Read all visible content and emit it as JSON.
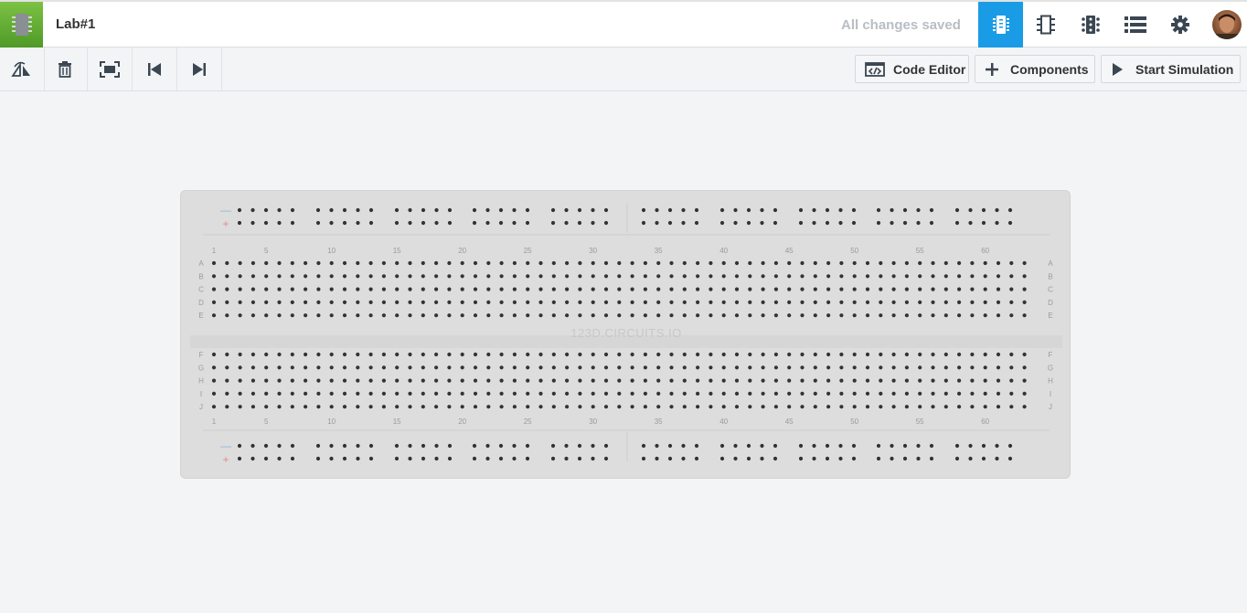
{
  "header": {
    "project_title": "Lab#1",
    "save_status": "All changes saved",
    "views": [
      {
        "name": "breadboard-view",
        "icon": "breadboard-chip-icon",
        "active": true
      },
      {
        "name": "schematic-view",
        "icon": "schematic-chip-icon",
        "active": false
      },
      {
        "name": "pcb-view",
        "icon": "pcb-chip-icon",
        "active": false
      },
      {
        "name": "component-list",
        "icon": "list-icon",
        "active": false
      },
      {
        "name": "settings",
        "icon": "gear-icon",
        "active": false
      }
    ],
    "colors": {
      "accent": "#1a9be6",
      "logo": "#6ab43a"
    }
  },
  "toolbar": {
    "tools": [
      "rotate-icon",
      "trash-icon",
      "fit-to-screen-icon",
      "step-back-icon",
      "step-forward-icon"
    ],
    "code_editor_label": "Code Editor",
    "components_label": "Components",
    "start_simulation_label": "Start Simulation"
  },
  "breadboard": {
    "brand": "123D.CIRCUITS.IO",
    "rows_top": [
      "A",
      "B",
      "C",
      "D",
      "E"
    ],
    "rows_bottom": [
      "F",
      "G",
      "H",
      "I",
      "J"
    ],
    "column_numbers": [
      "1",
      "5",
      "10",
      "15",
      "20",
      "25",
      "30",
      "35",
      "40",
      "45",
      "50",
      "55",
      "60"
    ],
    "rail_minus": "—",
    "rail_plus": "+"
  }
}
